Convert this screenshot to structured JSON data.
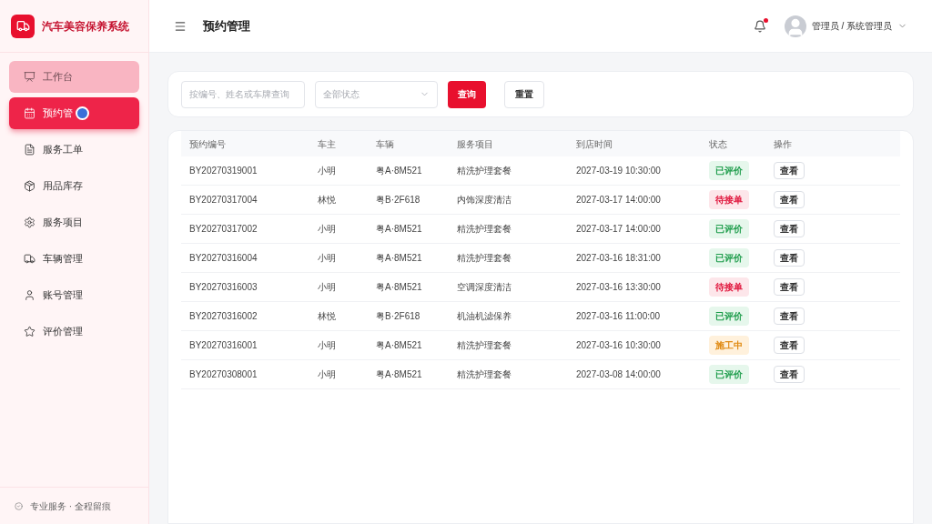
{
  "brand": {
    "name": "汽车美容保养系统"
  },
  "sidebar": {
    "items": [
      {
        "label": "工作台",
        "selected": false,
        "hovered": true
      },
      {
        "label": "预约管",
        "selected": true,
        "hovered": false
      },
      {
        "label": "服务工单",
        "selected": false,
        "hovered": false
      },
      {
        "label": "用品库存",
        "selected": false,
        "hovered": false
      },
      {
        "label": "服务项目",
        "selected": false,
        "hovered": false
      },
      {
        "label": "车辆管理",
        "selected": false,
        "hovered": false
      },
      {
        "label": "账号管理",
        "selected": false,
        "hovered": false
      },
      {
        "label": "评价管理",
        "selected": false,
        "hovered": false
      }
    ],
    "footer": "专业服务 · 全程留痕"
  },
  "header": {
    "title": "预约管理",
    "notification": true,
    "user": "管理员 / 系统管理员"
  },
  "filters": {
    "search_placeholder": "按编号、姓名或车牌查询",
    "status_placeholder": "全部状态",
    "buttons": [
      "查询",
      "重置"
    ]
  },
  "table": {
    "columns": [
      "预约编号",
      "车主",
      "车辆",
      "服务项目",
      "到店时间",
      "状态",
      "操作"
    ],
    "rows": [
      {
        "id": "BY20270319001",
        "owner": "小明",
        "vehicle": "粤A·8M521",
        "service": "精洗护理套餐",
        "time": "2027-03-19 10:30:00",
        "status": {
          "label": "已评价",
          "kind": "done"
        },
        "action": "查看"
      },
      {
        "id": "BY20270317004",
        "owner": "林悦",
        "vehicle": "粤B·2F618",
        "service": "内饰深度清洁",
        "time": "2027-03-17 14:00:00",
        "status": {
          "label": "待接单",
          "kind": "pending"
        },
        "action": "查看"
      },
      {
        "id": "BY20270317002",
        "owner": "小明",
        "vehicle": "粤A·8M521",
        "service": "精洗护理套餐",
        "time": "2027-03-17 14:00:00",
        "status": {
          "label": "已评价",
          "kind": "done"
        },
        "action": "查看"
      },
      {
        "id": "BY20270316004",
        "owner": "小明",
        "vehicle": "粤A·8M521",
        "service": "精洗护理套餐",
        "time": "2027-03-16 18:31:00",
        "status": {
          "label": "已评价",
          "kind": "done"
        },
        "action": "查看"
      },
      {
        "id": "BY20270316003",
        "owner": "小明",
        "vehicle": "粤A·8M521",
        "service": "空调深度清洁",
        "time": "2027-03-16 13:30:00",
        "status": {
          "label": "待接单",
          "kind": "pending"
        },
        "action": "查看"
      },
      {
        "id": "BY20270316002",
        "owner": "林悦",
        "vehicle": "粤B·2F618",
        "service": "机油机滤保养",
        "time": "2027-03-16 11:00:00",
        "status": {
          "label": "已评价",
          "kind": "done"
        },
        "action": "查看"
      },
      {
        "id": "BY20270316001",
        "owner": "小明",
        "vehicle": "粤A·8M521",
        "service": "精洗护理套餐",
        "time": "2027-03-16 10:30:00",
        "status": {
          "label": "施工中",
          "kind": "working"
        },
        "action": "查看"
      },
      {
        "id": "BY20270308001",
        "owner": "小明",
        "vehicle": "粤A·8M521",
        "service": "精洗护理套餐",
        "time": "2027-03-08 14:00:00",
        "status": {
          "label": "已评价",
          "kind": "done"
        },
        "action": "查看"
      }
    ]
  }
}
